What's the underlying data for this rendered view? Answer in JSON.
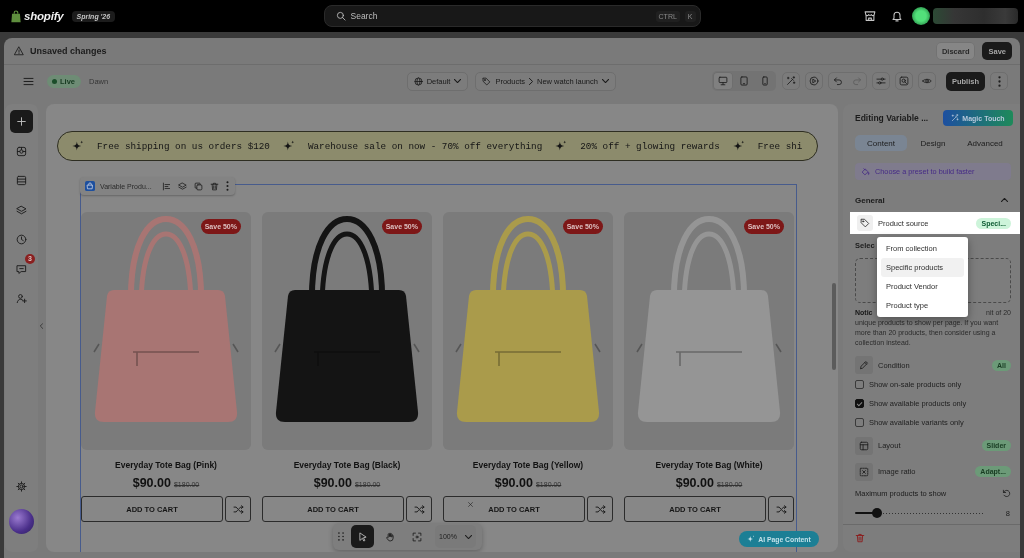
{
  "top_bar": {
    "logo": "shopify",
    "edition": "Spring '26",
    "search": {
      "placeholder": "Search",
      "shortcut": [
        "CTRL",
        "K"
      ]
    }
  },
  "unsaved_bar": {
    "message": "Unsaved changes",
    "actions": [
      {
        "label": "Discard",
        "kind": "secondary"
      },
      {
        "label": "Save",
        "kind": "primary"
      }
    ]
  },
  "toolbar": {
    "status": "Live",
    "theme": "Dawn",
    "locale": "Default",
    "breadcrumb": [
      "Products",
      "New watch launch"
    ],
    "devices": [
      {
        "kind": "desktop",
        "selected": true
      },
      {
        "kind": "tablet",
        "selected": false
      },
      {
        "kind": "mobile",
        "selected": false
      }
    ],
    "history": [
      {
        "kind": "undo",
        "disabled": false
      },
      {
        "kind": "redo",
        "disabled": true
      }
    ],
    "publish": "Publish"
  },
  "sidebar": {
    "items": [
      {
        "kind": "add"
      },
      {
        "kind": "sections"
      },
      {
        "kind": "blocks"
      },
      {
        "kind": "layers"
      },
      {
        "kind": "history"
      },
      {
        "kind": "comments",
        "badge": "3"
      },
      {
        "kind": "apps"
      }
    ],
    "footer": [
      {
        "kind": "settings"
      }
    ]
  },
  "announcement_bar": {
    "messages": [
      "Free shipping on us orders $120",
      "Warehouse sale on now - 70% off everything",
      "20% off + glowing rewards",
      "Free shi"
    ]
  },
  "section": {
    "label": "Variable Produ...",
    "products": [
      {
        "title": "Everyday Tote Bag (Pink)",
        "price": "$90.00",
        "compare_at_price": "$180.00",
        "badge": "Save 50%",
        "color": "#a87573",
        "button": "ADD TO CART"
      },
      {
        "title": "Everyday Tote Bag (Black)",
        "price": "$90.00",
        "compare_at_price": "$180.00",
        "badge": "Save 50%",
        "color": "#141414",
        "button": "ADD TO CART"
      },
      {
        "title": "Everyday Tote Bag (Yellow)",
        "price": "$90.00",
        "compare_at_price": "$180.00",
        "badge": "Save 50%",
        "color": "#aa9b4b",
        "button": "ADD TO CART"
      },
      {
        "title": "Everyday Tote Bag (White)",
        "price": "$90.00",
        "compare_at_price": "$180.00",
        "badge": "Save 50%",
        "color": "#959595",
        "button": "ADD TO CART"
      }
    ]
  },
  "canvas_toolbar": {
    "tools": [
      {
        "kind": "select",
        "selected": true
      },
      {
        "kind": "hand",
        "selected": false
      },
      {
        "kind": "focus",
        "selected": false
      }
    ],
    "zoom": "100%"
  },
  "ai_button": "AI Page Content",
  "panel": {
    "title": "Editing Variable ...",
    "magic_button": "Magic Touch",
    "tabs": [
      {
        "label": "Content",
        "selected": true
      },
      {
        "label": "Design",
        "selected": false
      },
      {
        "label": "Advanced",
        "selected": false
      }
    ],
    "preset_hint": "Choose a preset to build faster",
    "group": {
      "title": "General",
      "expanded": true
    },
    "product_source": {
      "label": "Product source",
      "value": "Speci...",
      "highlighted": true,
      "expanded": true,
      "options": [
        {
          "label": "From collection",
          "selected": false
        },
        {
          "label": "Specific products",
          "selected": true
        },
        {
          "label": "Product Vendor",
          "selected": false
        },
        {
          "label": "Product type",
          "selected": false
        }
      ]
    },
    "picker_label": "Selec",
    "notice": {
      "label": "Notic",
      "fragment": "nit of 20",
      "text": "unique products to show per page. If you want more than 20 products, then consider using a collection instead."
    },
    "settings": [
      {
        "kind": "condition",
        "label": "Condition",
        "value": "All"
      },
      {
        "kind": "checkbox",
        "label": "Show on-sale products only",
        "checked": false
      },
      {
        "kind": "checkbox",
        "label": "Show available products only",
        "checked": true
      },
      {
        "kind": "checkbox",
        "label": "Show available variants only",
        "checked": false
      },
      {
        "kind": "layout",
        "label": "Layout",
        "value": "Slider"
      },
      {
        "kind": "image_ratio",
        "label": "Image ratio",
        "value": "Adapt..."
      }
    ],
    "max_products": {
      "label": "Maximum products to show",
      "level": 0.17,
      "reading": "8"
    }
  }
}
